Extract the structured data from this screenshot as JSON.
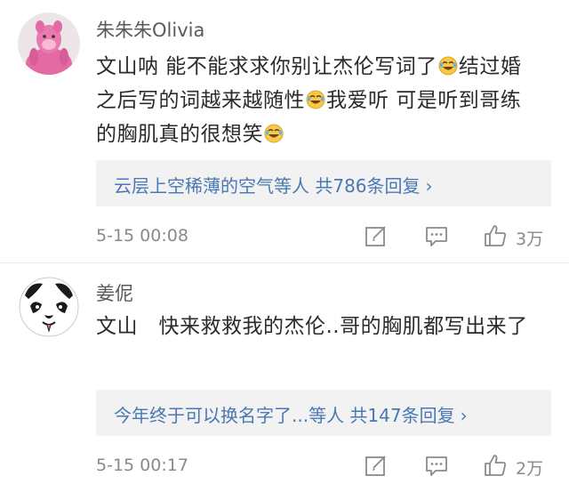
{
  "comments": [
    {
      "username": "朱朱朱Olivia",
      "avatar": "pink-panther-plush-avatar",
      "segments": [
        "文山呐 能不能求求你别让杰伦写词了",
        "结过婚之后写的词越来越随性",
        "我爱听 可是听到哥练的胸肌真的很想笑"
      ],
      "emoji": "laugh-cry-emoji",
      "replies": "云层上空稀薄的空气等人 共786条回复",
      "timestamp": "5-15 00:08",
      "likes": "3万"
    },
    {
      "username": "姜伲",
      "avatar": "panda-face-avatar",
      "text": "文山　快来救救我的杰伦..哥的胸肌都写出来了",
      "replies": "今年终于可以换名字了...等人 共147条回复",
      "timestamp": "5-15 00:17",
      "likes": "2万"
    }
  ],
  "icons": {
    "repost": "edit-icon",
    "comment": "comment-icon",
    "like": "thumbs-up-icon",
    "chevron": "chevron-right-icon"
  },
  "colors": {
    "link_blue": "#4a78b4",
    "meta_gray": "#8a8a8a",
    "reply_bg": "#f2f2f2"
  }
}
